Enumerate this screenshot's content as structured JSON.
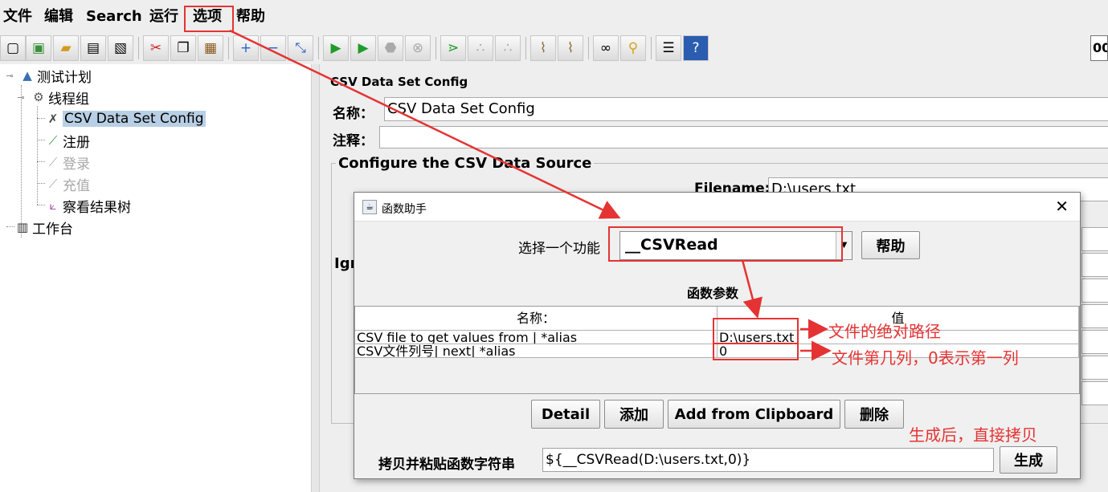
{
  "menu": [
    "文件",
    "编辑",
    "Search",
    "运行",
    "选项",
    "帮助"
  ],
  "toolbar": {
    "icons": [
      "new-icon",
      "templates-icon",
      "open-icon",
      "save-icon",
      "save-as-icon",
      "cut-icon",
      "copy-icon",
      "paste-icon",
      "expand-icon",
      "collapse-icon",
      "toggle-icon",
      "start-icon",
      "start-no-pause-icon",
      "stop-icon",
      "shutdown-icon",
      "remote-start-icon",
      "remote-stop-icon",
      "remote-shutdown-icon",
      "clear-icon",
      "clear-all-icon",
      "search-icon",
      "reset-search-icon",
      "function-helper-icon",
      "help-icon"
    ],
    "right_text": "00"
  },
  "tree": {
    "nodes": [
      {
        "label": "测试计划",
        "icon": "flask-icon"
      },
      {
        "label": "线程组",
        "icon": "gear-icon"
      },
      {
        "label": "CSV Data Set Config",
        "icon": "wrench-icon"
      },
      {
        "label": "注册",
        "icon": "pipette-icon"
      },
      {
        "label": "登录",
        "icon": "pipette-icon"
      },
      {
        "label": "充值",
        "icon": "pipette-icon"
      },
      {
        "label": "察看结果树",
        "icon": "graph-icon"
      },
      {
        "label": "工作台",
        "icon": "notebook-icon"
      }
    ]
  },
  "config": {
    "title": "CSV Data Set Config",
    "name_label": "名称：",
    "name_value": "CSV Data Set Config",
    "comment_label": "注释：",
    "group_title": "Configure the CSV Data Source",
    "filename_label": "Filename:",
    "filename_value": "D:\\users.txt",
    "partial_label": "Igr"
  },
  "dialog": {
    "title": "函数助手",
    "select_label": "选择一个功能",
    "function_value": "__CSVRead",
    "help_button": "帮助",
    "params_title": "函数参数",
    "table": {
      "headers": [
        "名称：",
        "值"
      ],
      "rows": [
        [
          "CSV file to get values from | *alias",
          "D:\\users.txt"
        ],
        [
          "CSV文件列号| next| *alias",
          "0"
        ]
      ]
    },
    "buttons": [
      "Detail",
      "添加",
      "Add from Clipboard",
      "删除"
    ],
    "copy_label": "拷贝并粘贴函数字符串",
    "function_string": "${__CSVRead(D:\\users.txt,0)}",
    "generate_button": "生成"
  },
  "annotations": {
    "note_path": "文件的绝对路径",
    "note_column": "文件第几列，0表示第一列",
    "note_copy": "生成后，直接拷贝",
    "color": "#e53333"
  }
}
